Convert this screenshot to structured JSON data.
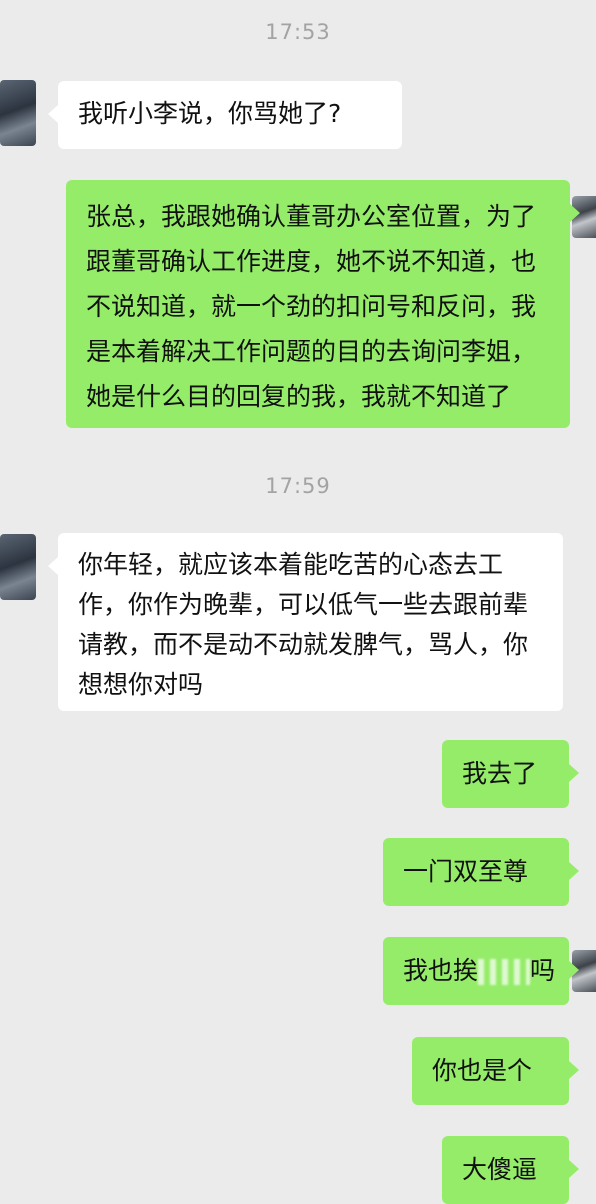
{
  "chat": {
    "time_1": "17:53",
    "time_2": "17:59",
    "messages": [
      "我听小李说，你骂她了?",
      "张总，我跟她确认董哥办公室位置，为了跟董哥确认工作进度，她不说不知道，也不说知道，就一个劲的扣问号和反问，我是本着解决工作问题的目的去询问李姐，她是什么目的回复的我，我就不知道了",
      "你年轻，就应该本着能吃苦的心态去工作，你作为晚辈，可以低气一些去跟前辈请教，而不是动不动就发脾气，骂人，你想想你对吗",
      "我去了",
      "一门双至尊",
      "我也挨",
      "吗",
      "你也是个",
      "大傻逼"
    ]
  },
  "colors": {
    "background": "#ebebeb",
    "outgoing_bubble": "#95ec69",
    "incoming_bubble": "#ffffff",
    "timestamp": "#a3a3a3"
  }
}
